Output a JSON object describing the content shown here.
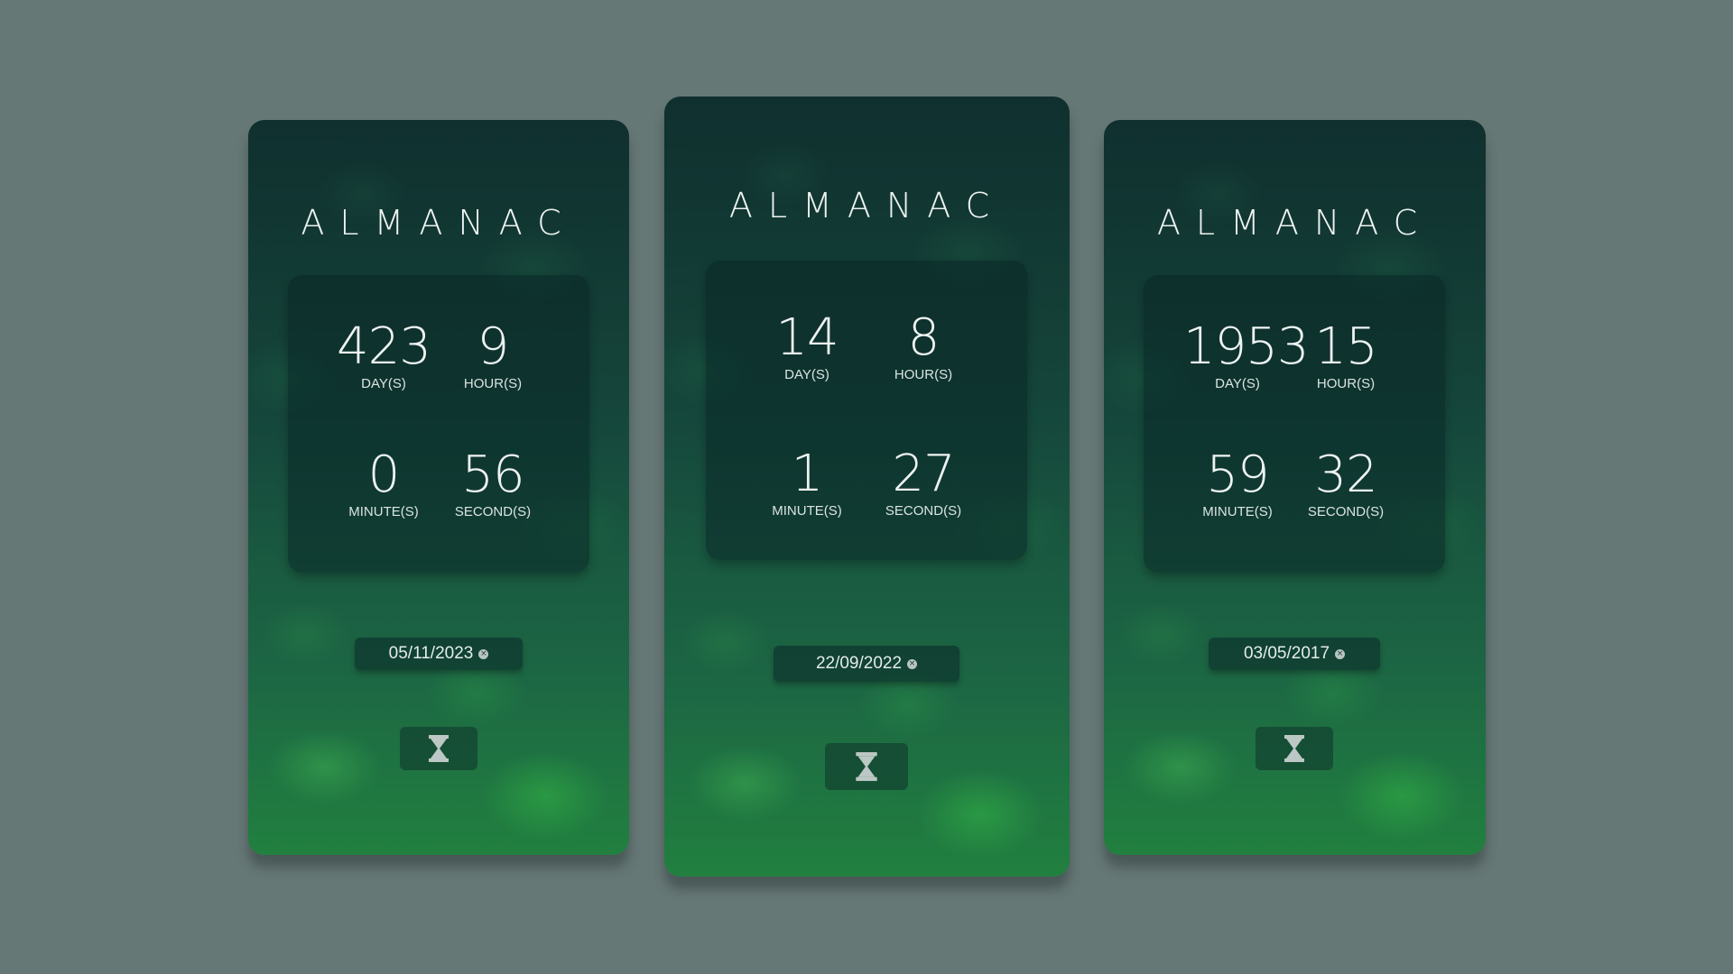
{
  "cards": [
    {
      "title": "ALMANAC",
      "days": "423",
      "days_label": "DAY(S)",
      "hours": "9",
      "hours_label": "HOUR(S)",
      "minutes": "0",
      "minutes_label": "MINUTE(S)",
      "seconds": "56",
      "seconds_label": "SECOND(S)",
      "date": "05/11/2023",
      "clear_icon": "×",
      "timer_icon": "hourglass-icon"
    },
    {
      "title": "ALMANAC",
      "days": "14",
      "days_label": "DAY(S)",
      "hours": "8",
      "hours_label": "HOUR(S)",
      "minutes": "1",
      "minutes_label": "MINUTE(S)",
      "seconds": "27",
      "seconds_label": "SECOND(S)",
      "date": "22/09/2022",
      "clear_icon": "×",
      "timer_icon": "hourglass-icon"
    },
    {
      "title": "ALMANAC",
      "days": "1953",
      "days_label": "DAY(S)",
      "hours": "15",
      "hours_label": "HOUR(S)",
      "minutes": "59",
      "minutes_label": "MINUTE(S)",
      "seconds": "32",
      "seconds_label": "SECOND(S)",
      "date": "03/05/2017",
      "clear_icon": "×",
      "timer_icon": "hourglass-icon"
    }
  ],
  "colors": {
    "background": "#667876",
    "text": "#eef3f1",
    "leaf_green": "#1c6644"
  }
}
